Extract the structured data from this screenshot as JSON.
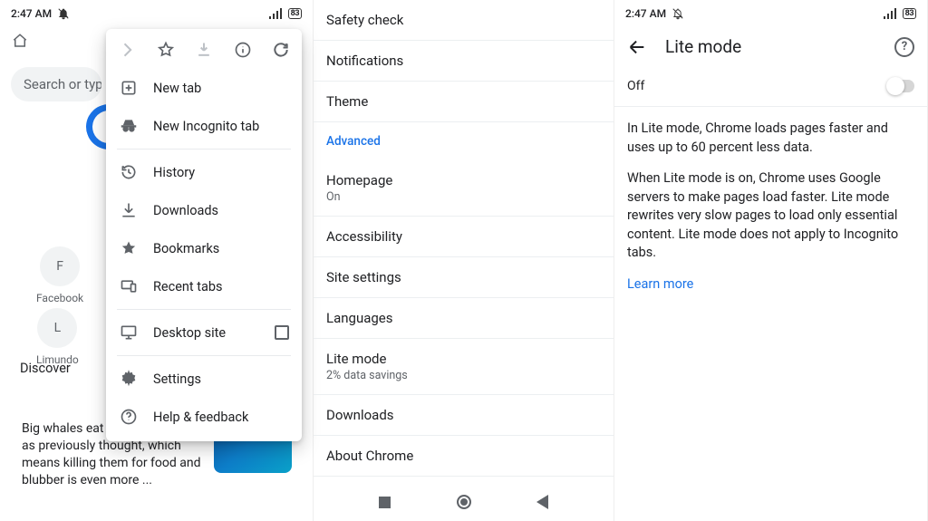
{
  "status": {
    "time": "2:47 AM",
    "battery": "83"
  },
  "pane1": {
    "search_placeholder": "Search or type",
    "shortcuts": [
      {
        "letter": "F",
        "label": "Facebook"
      },
      {
        "letter": "L",
        "label": "Limundo"
      }
    ],
    "discover_label": "Discover",
    "news_text": "Big whales eat 3 times as much as previously thought, which means killing them for food and blubber is even more ...",
    "menu": {
      "new_tab": "New tab",
      "incognito": "New Incognito tab",
      "history": "History",
      "downloads": "Downloads",
      "bookmarks": "Bookmarks",
      "recent": "Recent tabs",
      "desktop": "Desktop site",
      "settings": "Settings",
      "help": "Help & feedback"
    }
  },
  "pane2": {
    "items": {
      "safety": "Safety check",
      "notifications": "Notifications",
      "theme": "Theme",
      "advanced": "Advanced",
      "homepage_t": "Homepage",
      "homepage_s": "On",
      "accessibility": "Accessibility",
      "site": "Site settings",
      "languages": "Languages",
      "lite_t": "Lite mode",
      "lite_s": "2% data savings",
      "downloads": "Downloads",
      "about": "About Chrome"
    }
  },
  "pane3": {
    "title": "Lite mode",
    "toggle_label": "Off",
    "p1": "In Lite mode, Chrome loads pages faster and uses up to 60 percent less data.",
    "p2": "When Lite mode is on, Chrome uses Google servers to make pages load faster. Lite mode rewrites very slow pages to load only essential content. Lite mode does not apply to Incognito tabs.",
    "learn_more": "Learn more"
  }
}
